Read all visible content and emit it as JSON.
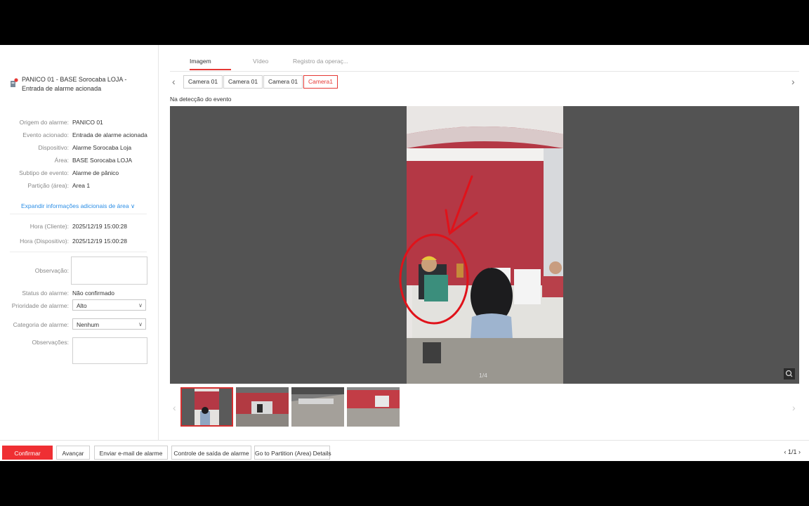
{
  "alarm": {
    "title": "PANICO 01 - BASE Sorocaba LOJA - Entrada de alarme acionada"
  },
  "details": [
    {
      "label": "Origem do alarme:",
      "value": "PANICO 01"
    },
    {
      "label": "Evento acionado:",
      "value": "Entrada de alarme acionada"
    },
    {
      "label": "Dispositivo:",
      "value": "Alarme Sorocaba Loja"
    },
    {
      "label": "Área:",
      "value": "BASE Sorocaba LOJA"
    },
    {
      "label": "Subtipo de evento:",
      "value": "Alarme de pânico"
    },
    {
      "label": "Partição (área):",
      "value": "Area 1"
    }
  ],
  "expand_label": "Expandir informações adicionais de área",
  "times": [
    {
      "label": "Hora (Cliente):",
      "value": "2025/12/19 15:00:28"
    },
    {
      "label": "Hora (Dispositivo):",
      "value": "2025/12/19 15:00:28"
    }
  ],
  "form": {
    "observacao_label": "Observação:",
    "status_label": "Status do alarme:",
    "status_value": "Não confirmado",
    "prioridade_label": "Prioridade de alarme:",
    "prioridade_value": "Alto",
    "categoria_label": "Categoria de alarme:",
    "categoria_value": "Nenhum",
    "observacoes_label": "Observações:"
  },
  "tabs": [
    "Imagem",
    "Vídeo",
    "Registro da operaç..."
  ],
  "cameras": [
    "Camera 01",
    "Camera 01",
    "Camera 01",
    "Camera1"
  ],
  "detect_label": "Na detecção do evento",
  "image_counter": "1/4",
  "footer": {
    "confirm": "Confirmar",
    "advance": "Avançar",
    "email": "Enviar e-mail de alarme",
    "exit": "Controle de saída de alarme",
    "partition": "Go to Partition (Area) Details",
    "page": "1/1"
  },
  "colors": {
    "accent": "#ef2f33",
    "link": "#2b8ee6",
    "annotation": "#e0121a"
  },
  "icons": [
    "alarm-device-icon",
    "chevron-down-icon",
    "chevron-left-icon",
    "chevron-right-icon",
    "zoom-icon"
  ]
}
